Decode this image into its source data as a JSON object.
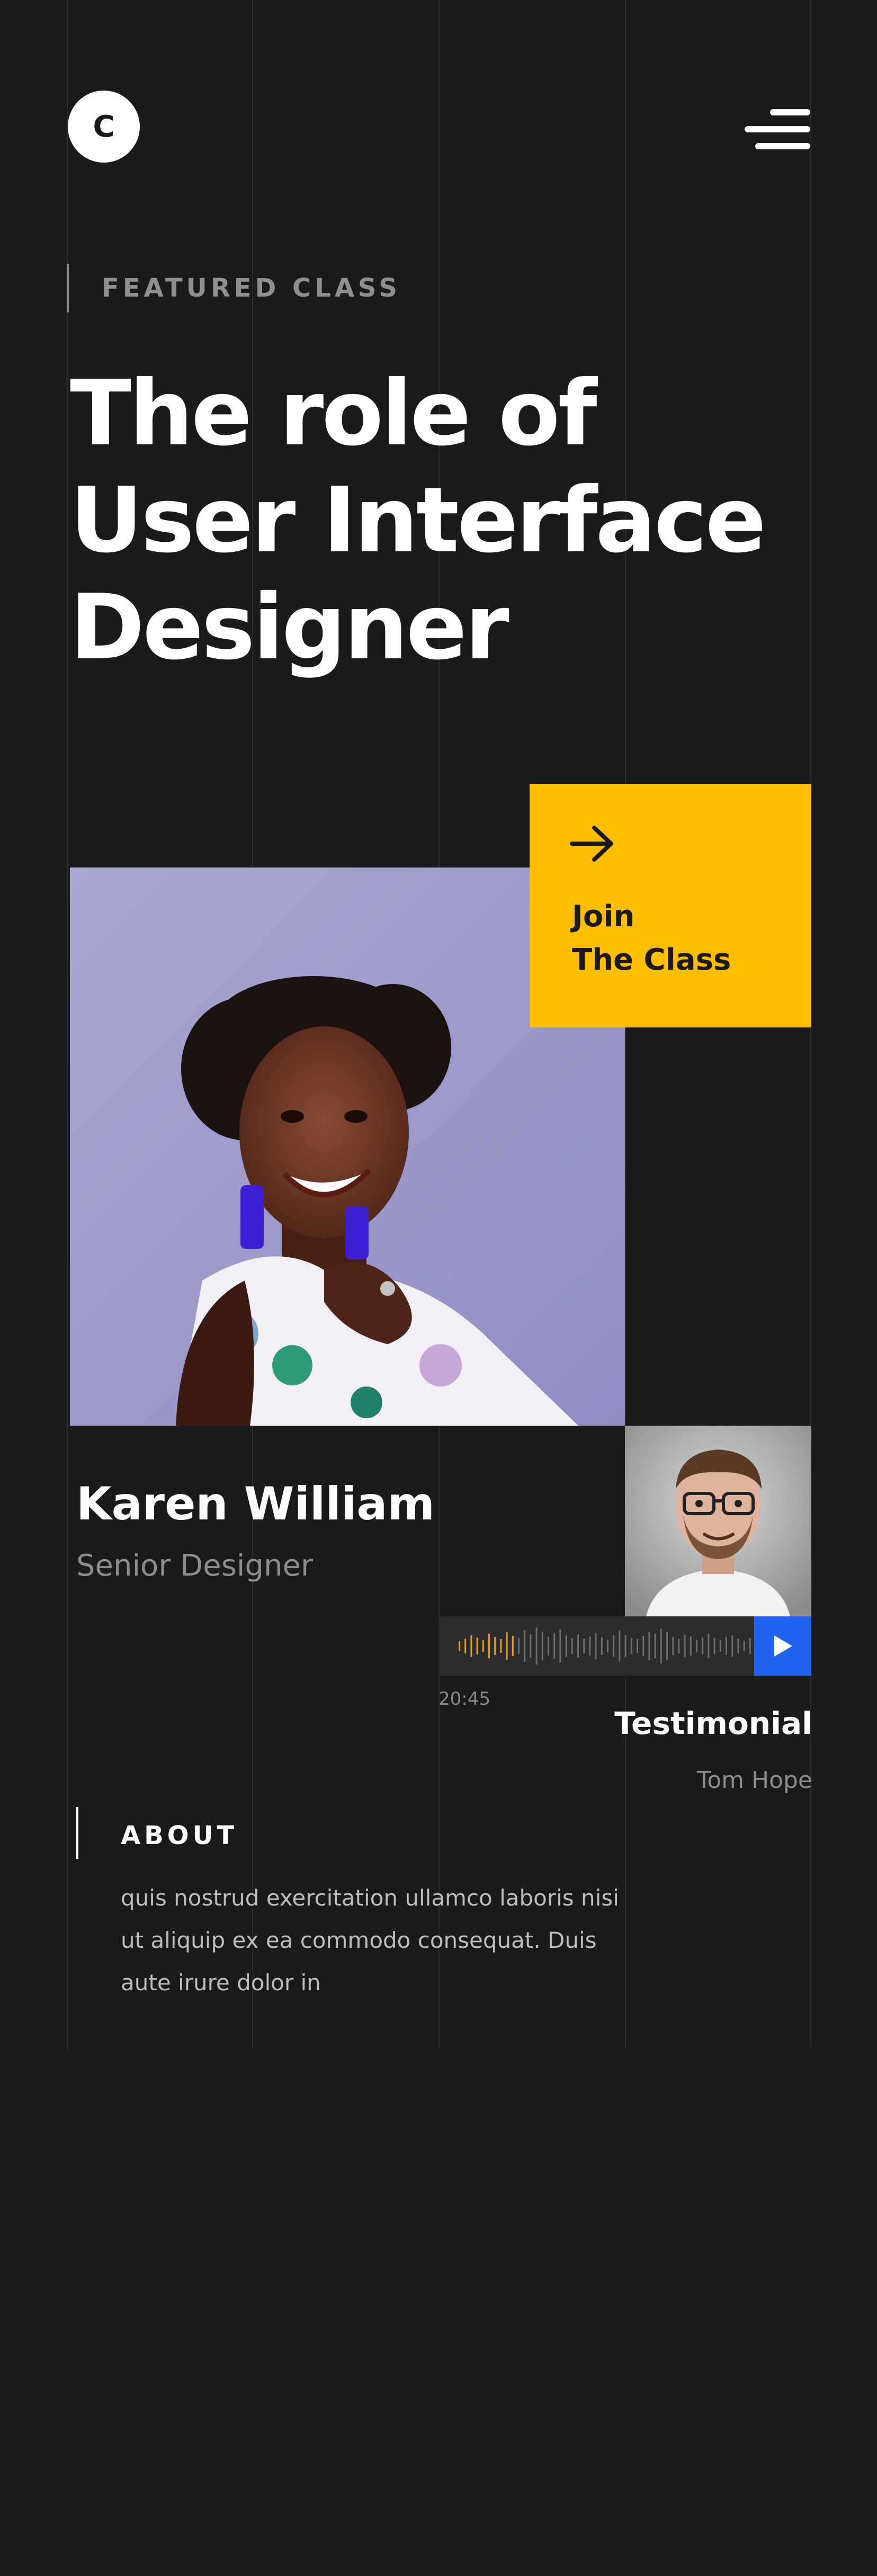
{
  "header": {
    "logo_text": "C",
    "menu_icon": "hamburger-menu-icon"
  },
  "hero": {
    "eyebrow": "FEATURED CLASS",
    "title_lines": [
      "The role of",
      "User Interface",
      "Designer"
    ]
  },
  "cta": {
    "icon": "arrow-right-icon",
    "label_lines": [
      "Join",
      "The Class"
    ],
    "color": "#ffbd00"
  },
  "instructor": {
    "name": "Karen William",
    "role": "Senior Designer"
  },
  "audio": {
    "time": "20:45",
    "play_icon": "play-icon",
    "play_color": "#1f63f0",
    "progress_color": "#e0a020"
  },
  "testimonial": {
    "label": "Testimonial",
    "author": "Tom Hope"
  },
  "about": {
    "label": "ABOUT",
    "body_lines": [
      "quis nostrud exercitation ullamco laboris nisi",
      "ut aliquip ex ea commodo consequat. Duis",
      "aute irure dolor in"
    ]
  },
  "colors": {
    "background": "#1a1a1a",
    "accent": "#ffbd00",
    "blue": "#1f63f0"
  }
}
